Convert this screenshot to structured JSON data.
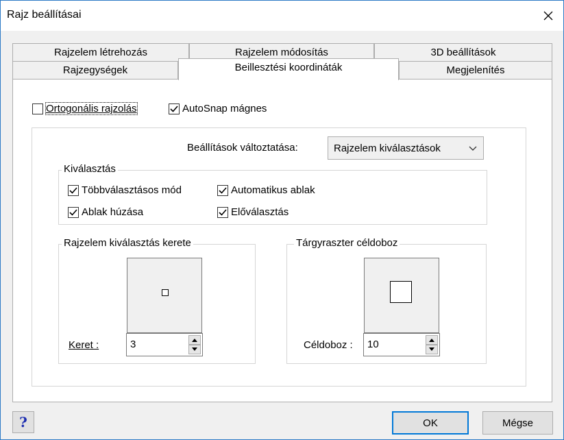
{
  "window": {
    "title": "Rajz beállításai",
    "close_glyph": "✕"
  },
  "tabs": {
    "back_row": [
      "Rajzelem létrehozás",
      "Rajzelem módosítás",
      "3D beállítások"
    ],
    "front_row": [
      "Rajzegységek",
      "Beillesztési koordináták",
      "Megjelenítés"
    ],
    "active": "Beillesztési koordináták"
  },
  "options": {
    "ortho": {
      "label": "Ortogonális rajzolás",
      "checked": false
    },
    "autosnap": {
      "label": "AutoSnap mágnes",
      "checked": true
    }
  },
  "settings_change": {
    "label": "Beállítások változtatása:",
    "value": "Rajzelem kiválasztások"
  },
  "selection": {
    "legend": "Kiválasztás",
    "items": [
      {
        "label": "Többválasztásos mód",
        "checked": true
      },
      {
        "label": "Automatikus ablak",
        "checked": true
      },
      {
        "label": "Ablak húzása",
        "checked": true
      },
      {
        "label": "Előválasztás",
        "checked": true
      }
    ]
  },
  "pickbox": {
    "legend": "Rajzelem kiválasztás kerete",
    "field_label": "Keret :",
    "value": "3"
  },
  "aperture": {
    "legend": "Tárgyraszter céldoboz",
    "field_label": "Céldoboz :",
    "value": "10"
  },
  "buttons": {
    "help": "?",
    "ok": "OK",
    "cancel": "Mégse"
  }
}
